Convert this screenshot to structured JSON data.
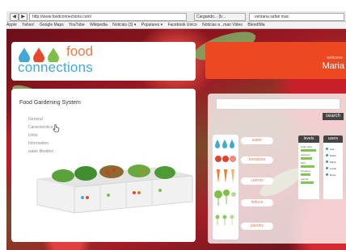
{
  "browser": {
    "url": "http://www.foodconnections.com/",
    "tab_title": "Cargando... (b...",
    "search_value": "ventana safari mac",
    "back_label": "◀",
    "forward_label": "▶",
    "bookmarks": [
      "Apple",
      "Yahoo!",
      "Google Maps",
      "YouTube",
      "Wikipedia",
      "Noticias (3) ▾",
      "Populares ▾",
      "Facebook Unico",
      "Noticias a ..man Video",
      "BlendIMa"
    ]
  },
  "header": {
    "logo_top": "food",
    "logo_bottom": "connections",
    "welcome_label": "welcome",
    "user_name": "Maria"
  },
  "main": {
    "title": "Food Gardening System",
    "menu": [
      "General",
      "Caracteristics",
      "Units",
      "Information",
      "water filtration"
    ]
  },
  "sidebar": {
    "search_button": "search",
    "categories": [
      "water",
      "tomatoes",
      "carrots",
      "lettuce",
      "parsley"
    ],
    "levels_header": "levels",
    "users_header": "users",
    "level_items": [
      {
        "label": "water tank",
        "value": 0.8
      },
      {
        "label": "nutrients",
        "value": 0.6
      },
      {
        "label": "light",
        "value": 0.7
      },
      {
        "label": "tomatoes",
        "value": 0.5
      },
      {
        "label": "carrots",
        "value": 0.65
      }
    ],
    "users": [
      "Ana",
      "Pedro",
      "Maria",
      "Lucas",
      "Rosa"
    ]
  },
  "colors": {
    "accent_orange": "#ec4923",
    "logo_blue": "#43a8d8",
    "logo_orange": "#f07a45",
    "dark_button": "#444444"
  }
}
